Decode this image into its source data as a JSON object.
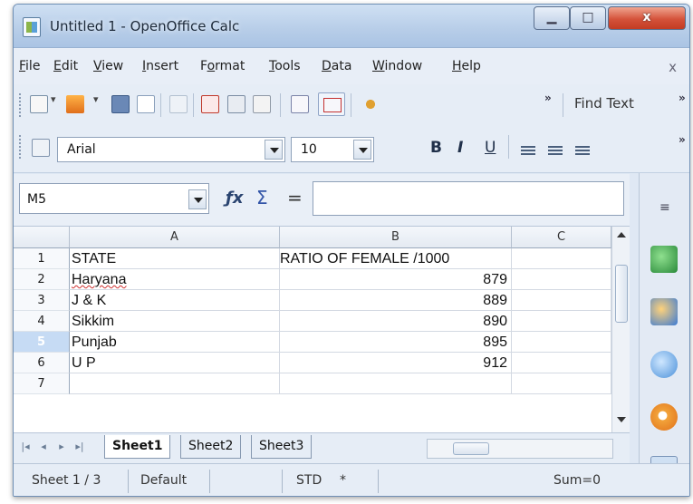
{
  "window": {
    "title": "Untitled 1 - OpenOffice Calc",
    "close_label": "x"
  },
  "menu": [
    {
      "label": "File",
      "key": "F",
      "rest": "ile"
    },
    {
      "label": "Edit",
      "key": "E",
      "rest": "dit"
    },
    {
      "label": "View",
      "key": "V",
      "rest": "iew"
    },
    {
      "label": "Insert",
      "key": "I",
      "rest": "nsert"
    },
    {
      "label": "Format",
      "key": "o",
      "pre": "F",
      "rest": "rmat"
    },
    {
      "label": "Tools",
      "key": "T",
      "rest": "ools"
    },
    {
      "label": "Data",
      "key": "D",
      "rest": "ata"
    },
    {
      "label": "Window",
      "key": "W",
      "rest": "indow"
    },
    {
      "label": "Help",
      "key": "H",
      "rest": "elp"
    }
  ],
  "toolbar": {
    "find_text_label": "Find Text",
    "font_name": "Arial",
    "font_size": "10",
    "bold": "B",
    "italic": "I",
    "underline": "U"
  },
  "formula": {
    "name_box": "M5",
    "input_value": ""
  },
  "sheet": {
    "columns": [
      "A",
      "B",
      "C"
    ],
    "rows": [
      {
        "num": "1",
        "a": "STATE",
        "b": "RATIO OF FEMALE /1000"
      },
      {
        "num": "2",
        "a": "Haryana",
        "b": "879"
      },
      {
        "num": "3",
        "a": "J & K",
        "b": "889"
      },
      {
        "num": "4",
        "a": "Sikkim",
        "b": "890"
      },
      {
        "num": "5",
        "a": "Punjab",
        "b": "895"
      },
      {
        "num": "6",
        "a": "U P",
        "b": "912"
      },
      {
        "num": "7",
        "a": "",
        "b": ""
      }
    ],
    "active_row": "5"
  },
  "tabs": [
    "Sheet1",
    "Sheet2",
    "Sheet3"
  ],
  "active_tab": "Sheet1",
  "status": {
    "sheet_pos": "Sheet 1 / 3",
    "page_style": "Default",
    "mode": "STD",
    "modified": "*",
    "sum": "Sum=0"
  },
  "icons": [
    "new-icon",
    "templates-icon",
    "save-icon",
    "email-icon",
    "edit-file-icon",
    "export-pdf-icon",
    "print-icon",
    "page-preview-icon",
    "spellcheck-icon",
    "autospellcheck-icon",
    "cut-icon",
    "styles-icon",
    "function-wizard-icon",
    "sum-icon",
    "equals-icon",
    "gallery-icon",
    "navigator-icon",
    "properties-icon",
    "functions-icon"
  ]
}
